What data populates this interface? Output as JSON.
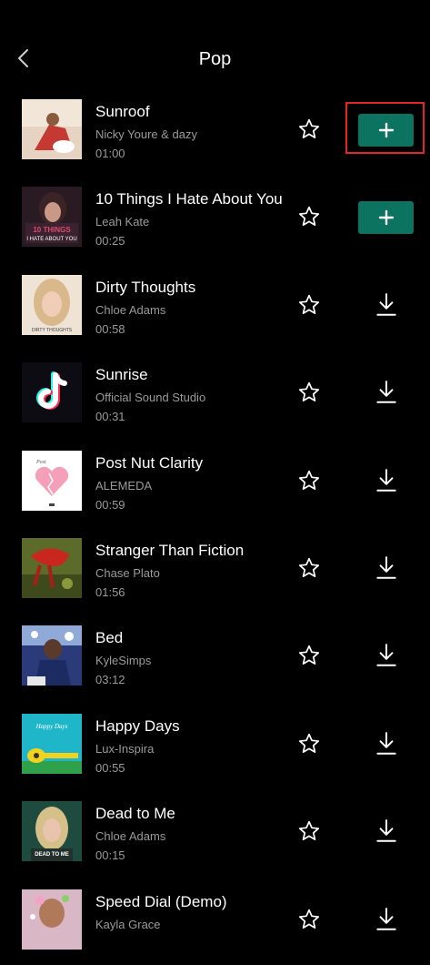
{
  "header": {
    "title": "Pop"
  },
  "colors": {
    "background": "#000000",
    "accent": "#0b7360",
    "highlight": "#e0262c",
    "secondary_text": "#9a9a9a"
  },
  "songs": [
    {
      "title": "Sunroof",
      "artist": "Nicky Youre & dazy",
      "duration": "01:00",
      "action": "add"
    },
    {
      "title": "10 Things I Hate About You",
      "artist": "Leah Kate",
      "duration": "00:25",
      "action": "add"
    },
    {
      "title": "Dirty Thoughts",
      "artist": "Chloe Adams",
      "duration": "00:58",
      "action": "download"
    },
    {
      "title": "Sunrise",
      "artist": "Official Sound Studio",
      "duration": "00:31",
      "action": "download"
    },
    {
      "title": "Post Nut Clarity",
      "artist": "ALEMEDA",
      "duration": "00:59",
      "action": "download"
    },
    {
      "title": "Stranger Than Fiction",
      "artist": "Chase Plato",
      "duration": "01:56",
      "action": "download"
    },
    {
      "title": "Bed",
      "artist": "KyleSimps",
      "duration": "03:12",
      "action": "download"
    },
    {
      "title": "Happy Days",
      "artist": "Lux-Inspira",
      "duration": "00:55",
      "action": "download"
    },
    {
      "title": "Dead to Me",
      "artist": "Chloe Adams",
      "duration": "00:15",
      "action": "download"
    },
    {
      "title": "Speed Dial (Demo)",
      "artist": "Kayla Grace",
      "duration": "",
      "action": "download"
    }
  ]
}
